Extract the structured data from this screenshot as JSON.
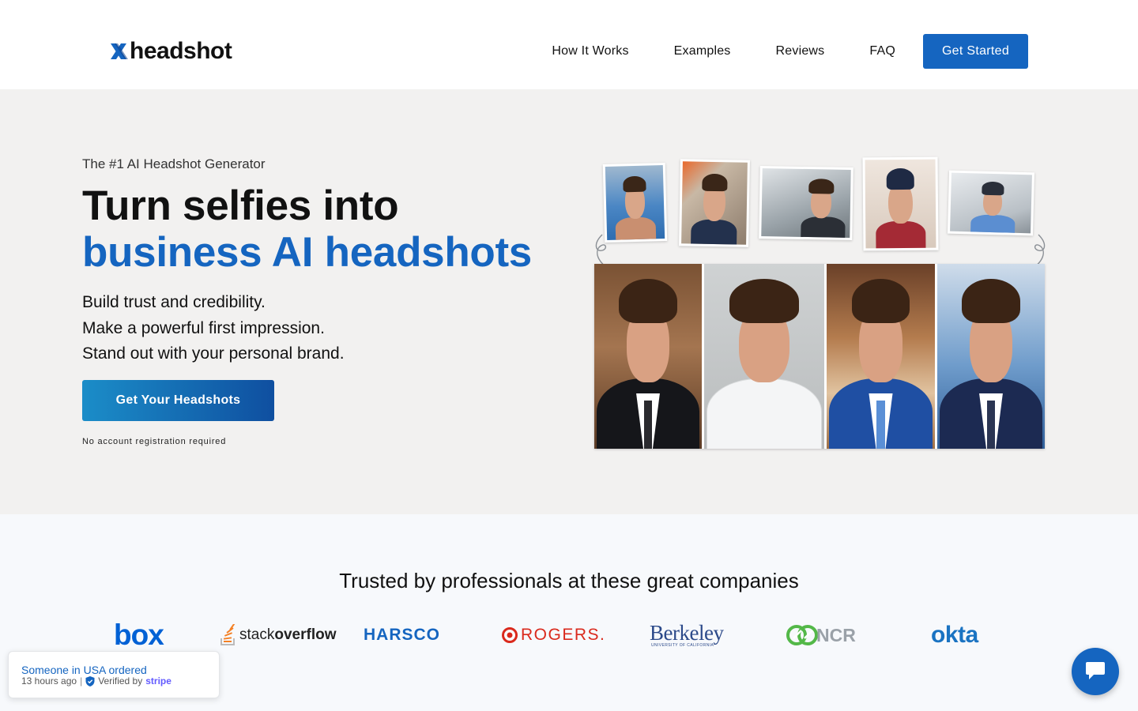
{
  "header": {
    "logo_text": "headshot",
    "nav": [
      "How It Works",
      "Examples",
      "Reviews",
      "FAQ"
    ],
    "cta_label": "Get Started"
  },
  "hero": {
    "eyebrow": "The #1 AI Headshot Generator",
    "headline_line1": "Turn selfies into",
    "headline_line2": "business AI headshots",
    "sub_lines": [
      "Build trust and credibility.",
      "Make a powerful first impression.",
      "Stand out with your personal brand."
    ],
    "cta_label": "Get Your Headshots",
    "note": "No account registration required"
  },
  "trusted": {
    "title": "Trusted by professionals at these great companies",
    "companies": [
      "box",
      "stackoverflow",
      "HARSCO",
      "ROGERS.",
      "Berkeley",
      "NCR",
      "okta"
    ],
    "berkeley_sub": "UNIVERSITY OF CALIFORNIA"
  },
  "toast": {
    "line1": "Someone in USA ordered",
    "time": "13 hours ago",
    "verified": "Verified by",
    "provider": "stripe"
  },
  "colors": {
    "brand_blue": "#1565c0",
    "hero_bg": "#f2f1f0",
    "trusted_bg": "#f7f9fc"
  },
  "icons": {
    "logo_mark": "x-logo-icon",
    "chat": "chat-bubble-icon",
    "verified": "shield-check-icon"
  }
}
